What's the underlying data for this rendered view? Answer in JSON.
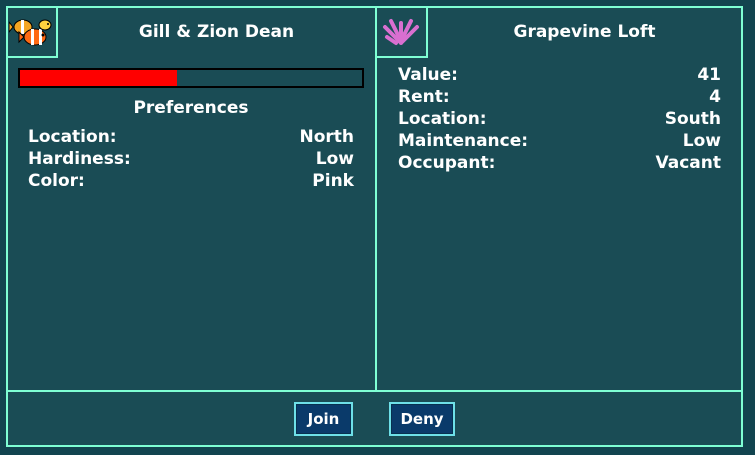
{
  "left_panel": {
    "icon": "clownfish-icon",
    "title": "Gill & Zion Dean",
    "happiness_fraction": 0.46,
    "bar_color": "#ff0000",
    "preferences_heading": "Preferences",
    "rows": [
      {
        "label": "Location:",
        "value": "North"
      },
      {
        "label": "Hardiness:",
        "value": "Low"
      },
      {
        "label": "Color:",
        "value": "Pink"
      }
    ]
  },
  "right_panel": {
    "icon": "coral-icon",
    "title": "Grapevine Loft",
    "rows": [
      {
        "label": "Value:",
        "value": "41"
      },
      {
        "label": "Rent:",
        "value": "4"
      },
      {
        "label": "Location:",
        "value": "South"
      },
      {
        "label": "Maintenance:",
        "value": "Low"
      },
      {
        "label": "Occupant:",
        "value": "Vacant"
      }
    ]
  },
  "actions": {
    "join_label": "Join",
    "deny_label": "Deny"
  },
  "colors": {
    "background": "#1a4c55",
    "border": "#7fffd4",
    "button": "#0a3a6a"
  }
}
